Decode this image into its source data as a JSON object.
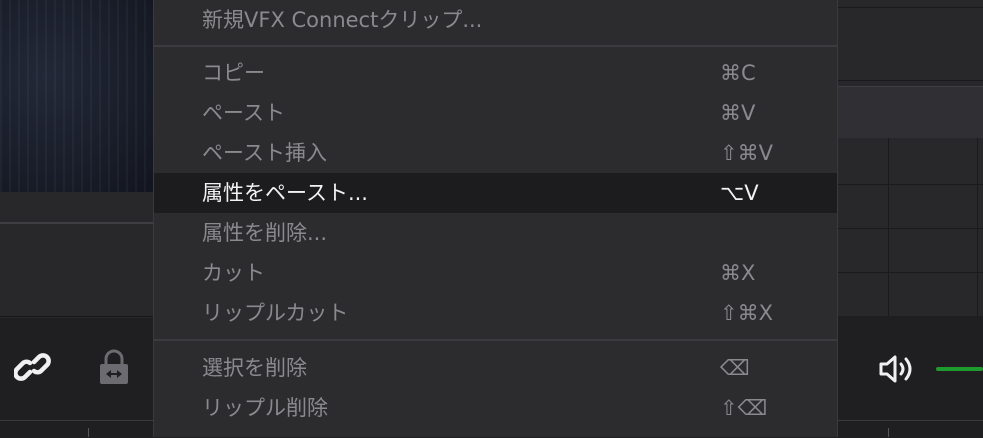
{
  "menu": {
    "items": [
      {
        "label": "新規VFX Connectクリップ...",
        "shortcut": ""
      },
      {
        "label": "コピー",
        "shortcut": "⌘C"
      },
      {
        "label": "ペースト",
        "shortcut": "⌘V"
      },
      {
        "label": "ペースト挿入",
        "shortcut": "⇧⌘V"
      },
      {
        "label": "属性をペースト...",
        "shortcut": "⌥V"
      },
      {
        "label": "属性を削除...",
        "shortcut": ""
      },
      {
        "label": "カット",
        "shortcut": "⌘X"
      },
      {
        "label": "リップルカット",
        "shortcut": "⇧⌘X"
      },
      {
        "label": "選択を削除",
        "shortcut": "⌫"
      },
      {
        "label": "リップル削除",
        "shortcut": "⇧⌫"
      }
    ],
    "highlighted_index": 4
  },
  "icons": {
    "left_toolbar": [
      "link-icon",
      "lock-icon"
    ],
    "right_toolbar": [
      "speaker-icon"
    ]
  },
  "colors": {
    "menu_bg": "#2c2c2f",
    "highlight_bg": "#1c1c1e",
    "text_dim": "#8a8a8e",
    "text_active": "#f2f2f4",
    "meter_green": "#1e9a2e"
  }
}
